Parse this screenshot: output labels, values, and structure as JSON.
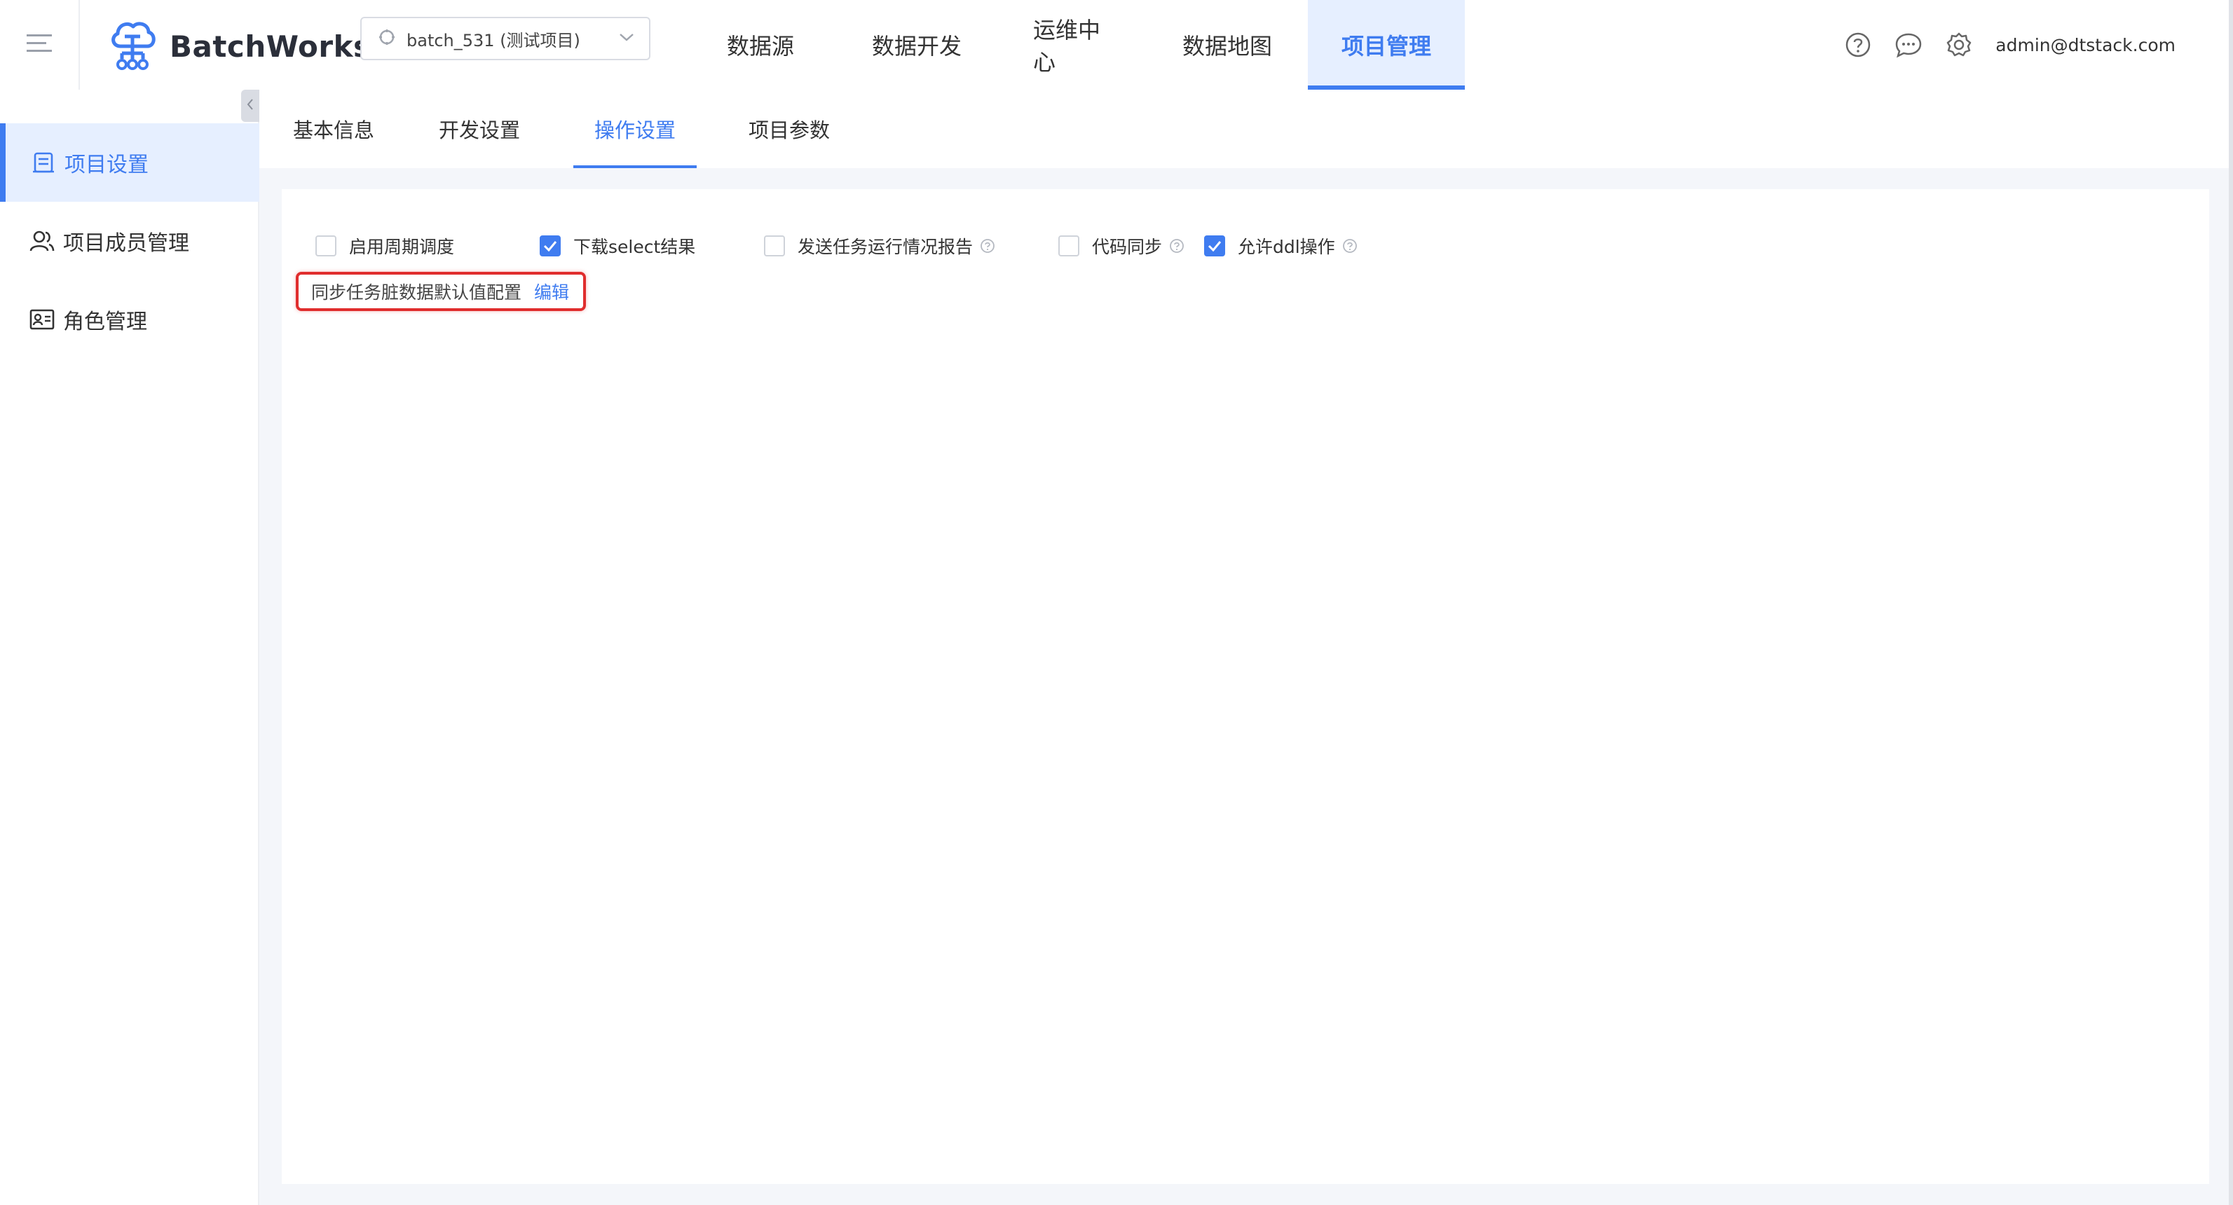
{
  "app": {
    "name": "BatchWorks",
    "project_selector": "batch_531 (测试项目)"
  },
  "nav": {
    "items": [
      {
        "label": "数据源",
        "active": false
      },
      {
        "label": "数据开发",
        "active": false
      },
      {
        "label": "运维中心",
        "active": false
      },
      {
        "label": "数据地图",
        "active": false
      },
      {
        "label": "项目管理",
        "active": true
      }
    ]
  },
  "header": {
    "user_email": "admin@dtstack.com",
    "icons": [
      "help-icon",
      "message-icon",
      "settings-icon"
    ]
  },
  "sidebar": {
    "items": [
      {
        "label": "项目设置",
        "icon": "project-settings-icon",
        "active": true
      },
      {
        "label": "项目成员管理",
        "icon": "users-icon",
        "active": false
      },
      {
        "label": "角色管理",
        "icon": "id-card-icon",
        "active": false
      }
    ]
  },
  "tabs": {
    "items": [
      {
        "label": "基本信息",
        "active": false
      },
      {
        "label": "开发设置",
        "active": false
      },
      {
        "label": "操作设置",
        "active": true
      },
      {
        "label": "项目参数",
        "active": false
      }
    ]
  },
  "options": {
    "items": [
      {
        "label": "启用周期调度",
        "checked": false,
        "help": false
      },
      {
        "label": "下载select结果",
        "checked": true,
        "help": false
      },
      {
        "label": "发送任务运行情况报告",
        "checked": false,
        "help": true
      },
      {
        "label": "代码同步",
        "checked": false,
        "help": true
      },
      {
        "label": "允许ddl操作",
        "checked": true,
        "help": true
      }
    ]
  },
  "dirty_data": {
    "label": "同步任务脏数据默认值配置",
    "edit_label": "编辑"
  },
  "colors": {
    "accent": "#3f7cf0",
    "active_bg": "#e6efff",
    "highlight_border": "#e02d2d"
  }
}
